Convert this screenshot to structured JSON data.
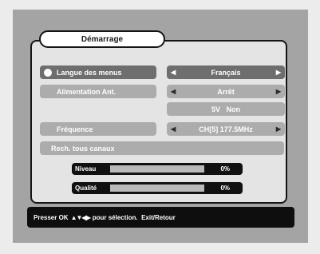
{
  "menu": {
    "title": "Démarrage",
    "rows": [
      {
        "label": "Langue des menus",
        "value": "Français"
      },
      {
        "label": "Alimentation Ant.",
        "value": "Arrêt"
      },
      {
        "label": "",
        "value": "5V   Non"
      },
      {
        "label": "Fréquence",
        "value": "CH[5] 177.5MHz"
      },
      {
        "label": "Rech. tous canaux",
        "value": ""
      }
    ],
    "meters": [
      {
        "label": "Niveau",
        "percent_text": "0%",
        "level": 0
      },
      {
        "label": "Qualité",
        "percent_text": "0%",
        "level": 0
      }
    ]
  },
  "footer": {
    "prefix": "Presser OK",
    "arrows": "▲▼◀▶",
    "suffix": "pour sélection.  Exit/Retour"
  },
  "icons": {
    "selected_bullet": "bullet-icon",
    "left": "triangle-left-icon",
    "right": "triangle-right-icon"
  },
  "colors": {
    "background": "#a4a4a4",
    "panel": "#e4e4e4",
    "label_box": "#acacac",
    "selected_box": "#6e6e6e",
    "footer": "#0e0e0e"
  }
}
